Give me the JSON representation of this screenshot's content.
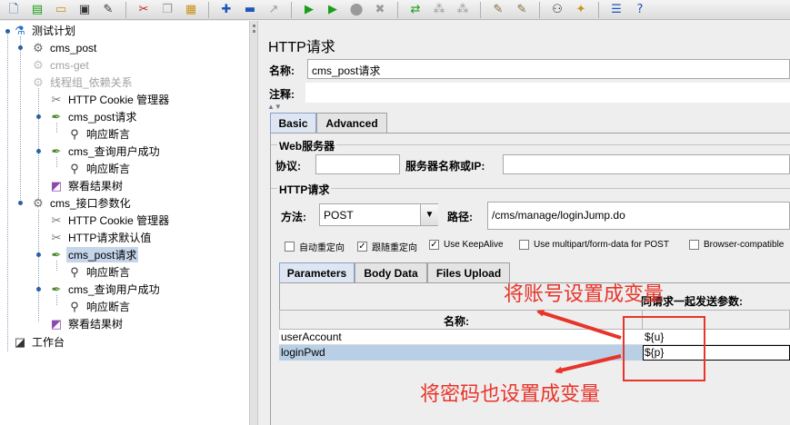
{
  "toolbar": {
    "icons": [
      "new-icon",
      "templates-icon",
      "open-icon",
      "save-icon",
      "save-as-icon",
      "cut-icon",
      "copy-icon",
      "paste-icon",
      "expand-icon",
      "collapse-icon",
      "toggle-icon",
      "start-icon",
      "start-no-pause-icon",
      "stop-icon",
      "shutdown-icon",
      "remote-start-icon",
      "remote-stop-icon",
      "remote-shutdown-icon",
      "clear-icon",
      "clear-all-icon",
      "search-icon",
      "reset-search-icon",
      "function-helper-icon",
      "help-icon"
    ]
  },
  "tree": {
    "items": [
      {
        "label": "测试计划",
        "icon": "flask-icon"
      },
      {
        "label": "cms_post",
        "icon": "gear-icon"
      },
      {
        "label": "cms-get",
        "icon": "gear-icon",
        "disabled": true
      },
      {
        "label": "线程组_依赖关系",
        "icon": "gear-icon",
        "disabled": true
      },
      {
        "label": "HTTP Cookie 管理器",
        "icon": "wrench-icon"
      },
      {
        "label": "cms_post请求",
        "icon": "pipette-icon"
      },
      {
        "label": "响应断言",
        "icon": "magnifier-icon"
      },
      {
        "label": "cms_查询用户成功",
        "icon": "pipette-icon"
      },
      {
        "label": "响应断言",
        "icon": "magnifier-icon"
      },
      {
        "label": "察看结果树",
        "icon": "chart-icon"
      },
      {
        "label": "cms_接口参数化",
        "icon": "gear-icon"
      },
      {
        "label": "HTTP Cookie 管理器",
        "icon": "wrench-icon"
      },
      {
        "label": "HTTP请求默认值",
        "icon": "wrench-icon"
      },
      {
        "label": "cms_post请求",
        "icon": "pipette-icon",
        "selected": true
      },
      {
        "label": "响应断言",
        "icon": "magnifier-icon"
      },
      {
        "label": "cms_查询用户成功",
        "icon": "pipette-icon"
      },
      {
        "label": "响应断言",
        "icon": "magnifier-icon"
      },
      {
        "label": "察看结果树",
        "icon": "chart-icon"
      },
      {
        "label": "工作台",
        "icon": "workbench-icon"
      }
    ]
  },
  "panel": {
    "title": "HTTP请求",
    "name_label": "名称:",
    "name_value": "cms_post请求",
    "comment_label": "注释:",
    "tabs": [
      "Basic",
      "Advanced"
    ],
    "web_server": {
      "group_title": "Web服务器",
      "protocol_label": "协议:",
      "protocol_value": "",
      "server_label": "服务器名称或IP:",
      "server_value": ""
    },
    "http_request": {
      "group_title": "HTTP请求",
      "method_label": "方法:",
      "method_value": "POST",
      "path_label": "路径:",
      "path_value": "/cms/manage/loginJump.do"
    },
    "checkboxes": [
      {
        "label": "自动重定向",
        "checked": false
      },
      {
        "label": "跟随重定向",
        "checked": true
      },
      {
        "label": "Use KeepAlive",
        "checked": true
      },
      {
        "label": "Use multipart/form-data for POST",
        "checked": false
      },
      {
        "label": "Browser-compatible",
        "checked": false
      }
    ],
    "sub_tabs": [
      "Parameters",
      "Body Data",
      "Files Upload"
    ],
    "params_header": "同请求一起发送参数:",
    "params_name_col": "名称:",
    "params_rows": [
      {
        "name": "userAccount",
        "value": "${u}"
      },
      {
        "name": "loginPwd",
        "value": "${p}"
      }
    ]
  },
  "annotations": {
    "top": "将账号设置成变量",
    "bottom": "将密码也设置成变量",
    "color": "#e8342a"
  }
}
